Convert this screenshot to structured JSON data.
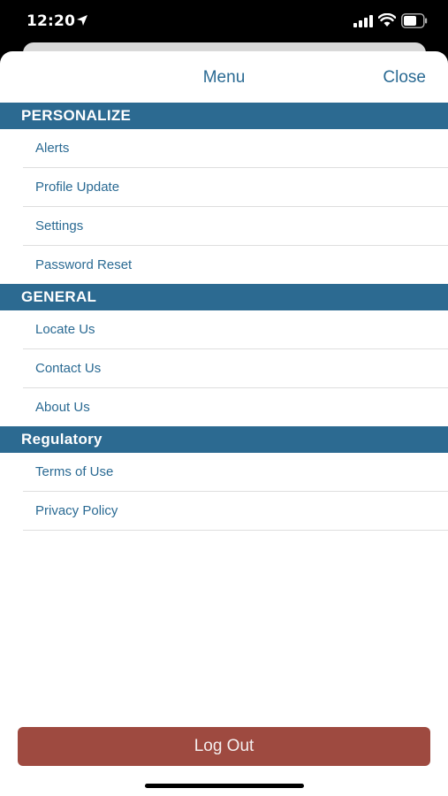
{
  "status_bar": {
    "time": "12:20"
  },
  "header": {
    "title": "Menu",
    "close_label": "Close"
  },
  "sections": [
    {
      "title": "PERSONALIZE",
      "items": [
        "Alerts",
        "Profile Update",
        "Settings",
        "Password Reset"
      ]
    },
    {
      "title": "GENERAL",
      "items": [
        "Locate Us",
        "Contact Us",
        "About Us"
      ]
    },
    {
      "title": "Regulatory",
      "items": [
        "Terms of Use",
        "Privacy Policy"
      ]
    }
  ],
  "logout_label": "Log Out",
  "colors": {
    "accent": "#2a6a93",
    "section_bg": "#2c6a91",
    "logout_bg": "#9e4a40"
  },
  "icons": [
    "location-arrow-icon",
    "cellular-signal-icon",
    "wifi-icon",
    "battery-icon"
  ]
}
